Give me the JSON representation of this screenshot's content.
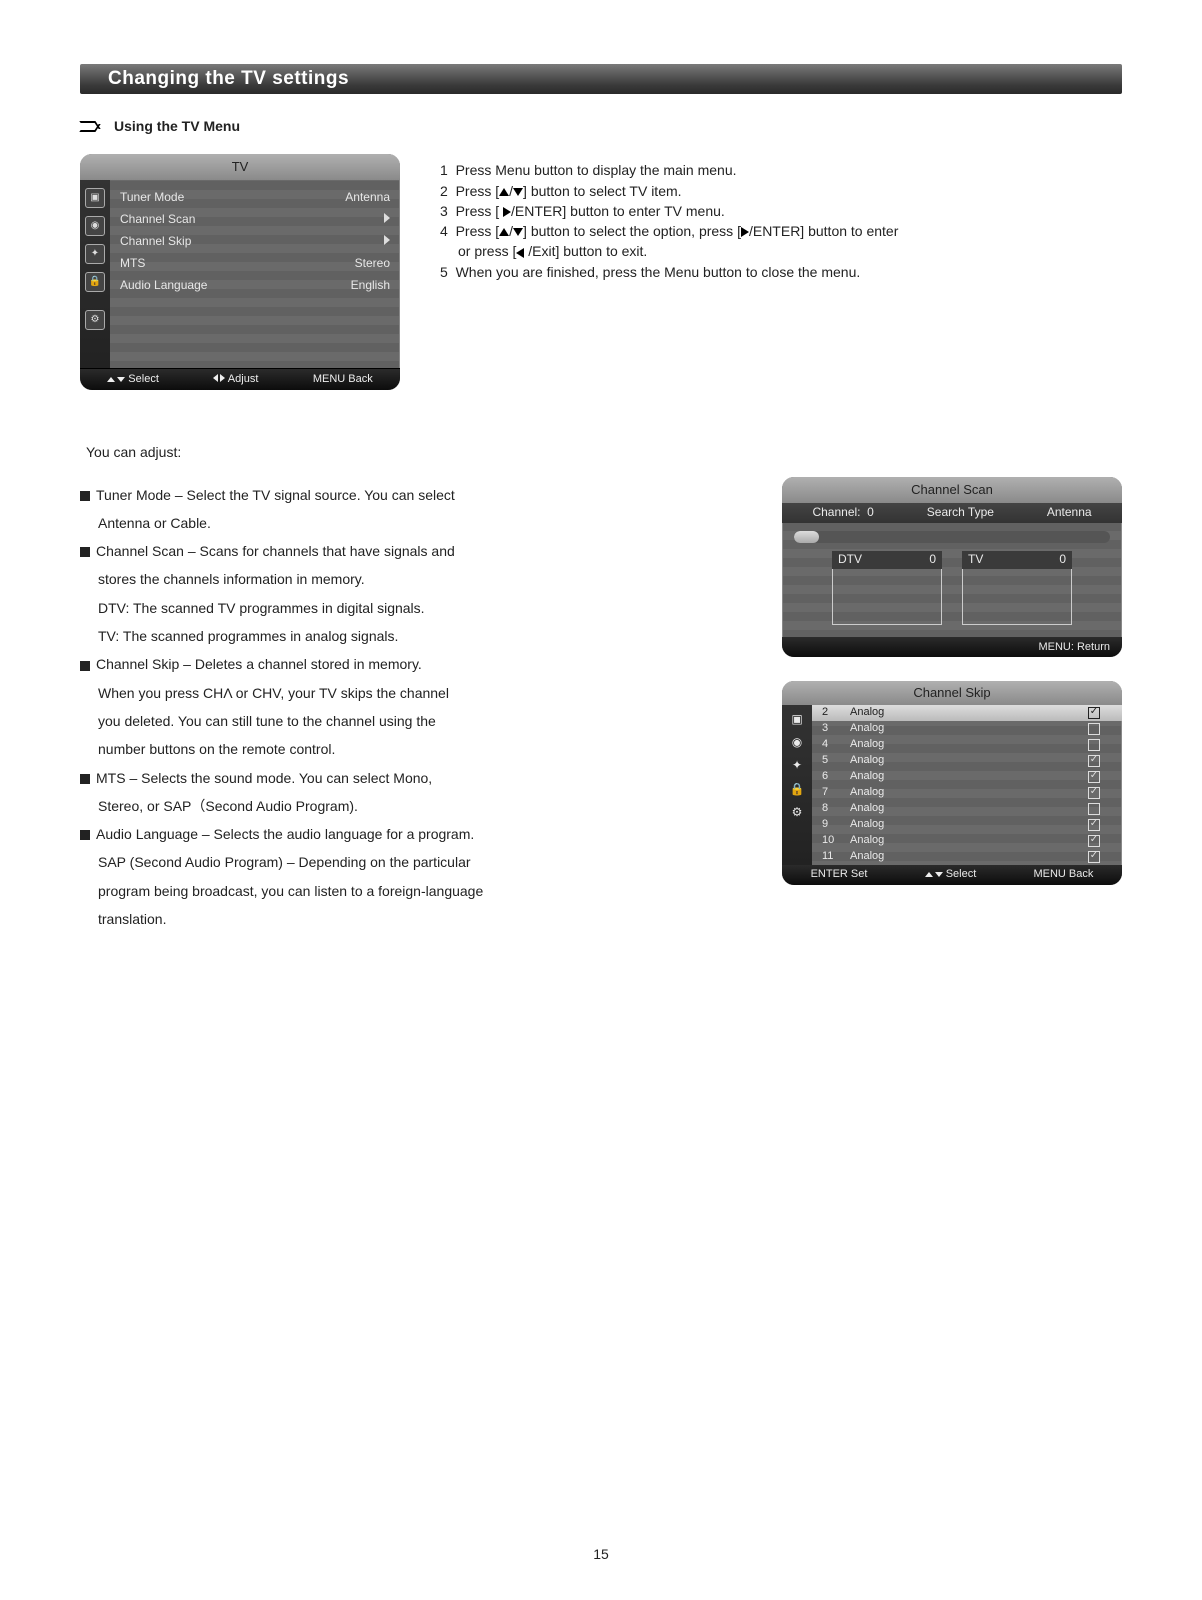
{
  "header": {
    "title": "Changing the TV settings"
  },
  "section": {
    "title": "Using the TV Menu"
  },
  "tvMenu": {
    "title": "TV",
    "items": [
      {
        "label": "Tuner Mode",
        "value": "Antenna",
        "arrow": false
      },
      {
        "label": "Channel  Scan",
        "value": "",
        "arrow": true
      },
      {
        "label": "Channel  Skip",
        "value": "",
        "arrow": true
      },
      {
        "label": "MTS",
        "value": "Stereo",
        "arrow": false
      },
      {
        "label": "Audio  Language",
        "value": "English",
        "arrow": false
      }
    ],
    "footer": {
      "select": "Select",
      "adjust": "Adjust",
      "menu": "MENU Back"
    }
  },
  "steps": {
    "s1": "Press Menu button to display the main menu.",
    "s2a": "Press [",
    "s2b": "] button to select TV item.",
    "s3a": "Press [ ",
    "s3b": "/ENTER] button to enter TV menu.",
    "s4a": "Press [",
    "s4b": "] button to select the option, press [",
    "s4c": "/ENTER] button to enter",
    "s4d": "or press [",
    "s4e": " /Exit] button to exit.",
    "s5": "When you are finished, press the Menu button to close the menu."
  },
  "adjustIntro": "You  can  adjust:",
  "bullets": {
    "b1a": "Tuner Mode – Select the TV signal source.   You can select",
    "b1b": "Antenna or Cable.",
    "b2a": "Channel Scan – Scans for channels that have signals and",
    "b2b": "stores the channels information in memory.",
    "b2c": "DTV: The scanned TV programmes in digital signals.",
    "b2d": "TV: The scanned programmes in analog signals.",
    "b3a": "Channel Skip – Deletes a channel stored in memory.",
    "b3b": "When you press CHΛ or CHV,  your TV skips the  channel",
    "b3c": "you deleted.  You can still tune to the channel using the",
    "b3d": "number buttons on the remote control.",
    "b4a": "MTS – Selects the sound mode.  You can select Mono,",
    "b4b": "Stereo,  or SAP（Second Audio Program).",
    "b5a": "Audio Language – Selects the audio language for a program.",
    "b5b": "SAP (Second Audio Program) – Depending on the particular",
    "b5c": "program being broadcast, you can listen to a foreign-language",
    "b5d": "translation."
  },
  "scan": {
    "title": "Channel Scan",
    "channelLbl": "Channel:",
    "channelVal": "0",
    "searchLbl": "Search Type",
    "searchVal": "Antenna",
    "percent": "8%",
    "progress": 8,
    "dtvLbl": "DTV",
    "dtvVal": "0",
    "tvLbl": "TV",
    "tvVal": "0",
    "footer": "MENU:  Return"
  },
  "skip": {
    "title": "Channel Skip",
    "items": [
      {
        "num": "2",
        "type": "Analog",
        "checked": true,
        "selected": true
      },
      {
        "num": "3",
        "type": "Analog",
        "checked": false,
        "selected": false
      },
      {
        "num": "4",
        "type": "Analog",
        "checked": false,
        "selected": false
      },
      {
        "num": "5",
        "type": "Analog",
        "checked": true,
        "selected": false
      },
      {
        "num": "6",
        "type": "Analog",
        "checked": true,
        "selected": false
      },
      {
        "num": "7",
        "type": "Analog",
        "checked": true,
        "selected": false
      },
      {
        "num": "8",
        "type": "Analog",
        "checked": false,
        "selected": false
      },
      {
        "num": "9",
        "type": "Analog",
        "checked": true,
        "selected": false
      },
      {
        "num": "10",
        "type": "Analog",
        "checked": true,
        "selected": false
      },
      {
        "num": "11",
        "type": "Analog",
        "checked": true,
        "selected": false
      }
    ],
    "footer": {
      "enter": "ENTER  Set",
      "select": "Select",
      "menu": "MENU  Back"
    }
  },
  "pageNumber": "15"
}
